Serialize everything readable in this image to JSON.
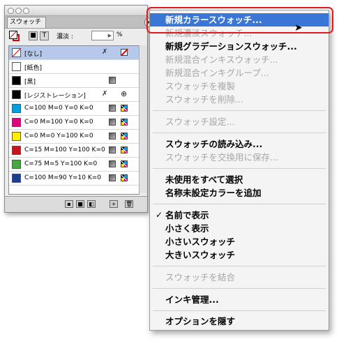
{
  "panel": {
    "tab_label": "スウォッチ",
    "tint_label": "濃淡 :",
    "tint_value": "",
    "percent_label": "%",
    "swatches": [
      {
        "name": "[なし]",
        "color": "none",
        "selected": true
      },
      {
        "name": "[紙色]",
        "color": "#ffffff"
      },
      {
        "name": "[黒]",
        "color": "#000000"
      },
      {
        "name": "[レジストレーション]",
        "color": "#000000"
      },
      {
        "name": "C=100 M=0 Y=0 K=0",
        "color": "#00a0e0"
      },
      {
        "name": "C=0 M=100 Y=0 K=0",
        "color": "#e0007d"
      },
      {
        "name": "C=0 M=0 Y=100 K=0",
        "color": "#fff000"
      },
      {
        "name": "C=15 M=100 Y=100 K=0",
        "color": "#c4161c"
      },
      {
        "name": "C=75 M=5 Y=100 K=0",
        "color": "#47a843"
      },
      {
        "name": "C=100 M=90 Y=10 K=0",
        "color": "#1a3d8f"
      }
    ]
  },
  "menu": {
    "items": [
      {
        "label": "新規カラースウォッチ...",
        "enabled": true,
        "highlighted": true
      },
      {
        "label": "新規濃淡スウォッチ...",
        "enabled": false
      },
      {
        "label": "新規グラデーションスウォッチ...",
        "enabled": true
      },
      {
        "label": "新規混合インキスウォッチ...",
        "enabled": false
      },
      {
        "label": "新規混合インキグループ...",
        "enabled": false
      },
      {
        "label": "スウォッチを複製",
        "enabled": false
      },
      {
        "label": "スウォッチを削除...",
        "enabled": false
      },
      {
        "label": "スウォッチ設定...",
        "enabled": false
      },
      {
        "label": "スウォッチの読み込み...",
        "enabled": true
      },
      {
        "label": "スウォッチを交換用に保存...",
        "enabled": false
      },
      {
        "label": "未使用をすべて選択",
        "enabled": true
      },
      {
        "label": "名称未設定カラーを追加",
        "enabled": true
      },
      {
        "label": "名前で表示",
        "enabled": true,
        "checked": true
      },
      {
        "label": "小さく表示",
        "enabled": true
      },
      {
        "label": "小さいスウォッチ",
        "enabled": true
      },
      {
        "label": "大きいスウォッチ",
        "enabled": true
      },
      {
        "label": "スウォッチを結合",
        "enabled": false
      },
      {
        "label": "インキ管理...",
        "enabled": true
      },
      {
        "label": "オプションを隠す",
        "enabled": true
      }
    ],
    "check_glyph": "✓"
  },
  "colors": {
    "highlight": "#3a76d6",
    "annotation_ring": "#e0191f",
    "disabled_text": "#a6a6a6"
  }
}
